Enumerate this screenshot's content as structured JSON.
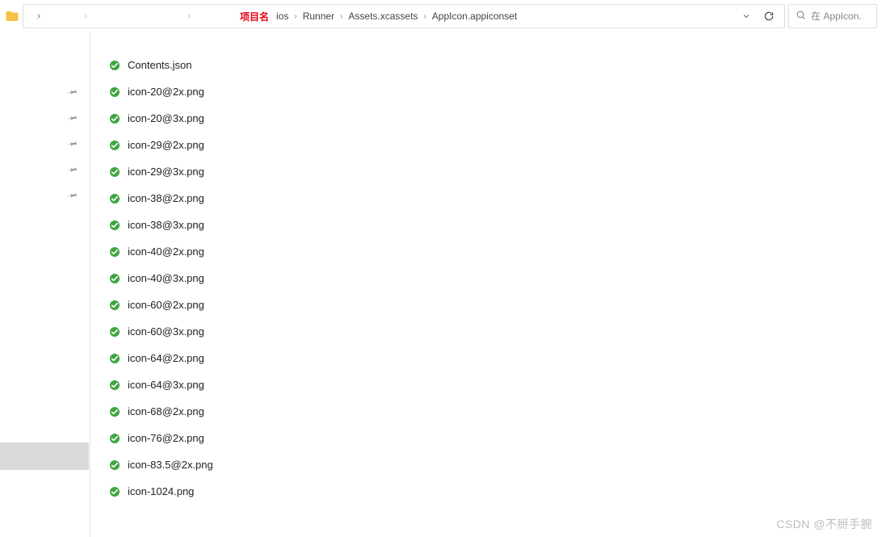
{
  "annotation": "项目名",
  "breadcrumbs": [
    "ios",
    "Runner",
    "Assets.xcassets",
    "AppIcon.appiconset"
  ],
  "search": {
    "placeholder": "在 AppIcon."
  },
  "sidebar": {
    "pinned_count": 5
  },
  "files": [
    {
      "name": "Contents.json"
    },
    {
      "name": "icon-20@2x.png"
    },
    {
      "name": "icon-20@3x.png"
    },
    {
      "name": "icon-29@2x.png"
    },
    {
      "name": "icon-29@3x.png"
    },
    {
      "name": "icon-38@2x.png"
    },
    {
      "name": "icon-38@3x.png"
    },
    {
      "name": "icon-40@2x.png"
    },
    {
      "name": "icon-40@3x.png"
    },
    {
      "name": "icon-60@2x.png"
    },
    {
      "name": "icon-60@3x.png"
    },
    {
      "name": "icon-64@2x.png"
    },
    {
      "name": "icon-64@3x.png"
    },
    {
      "name": "icon-68@2x.png"
    },
    {
      "name": "icon-76@2x.png"
    },
    {
      "name": "icon-83.5@2x.png"
    },
    {
      "name": "icon-1024.png"
    }
  ],
  "watermark": "CSDN @不掰手腕"
}
